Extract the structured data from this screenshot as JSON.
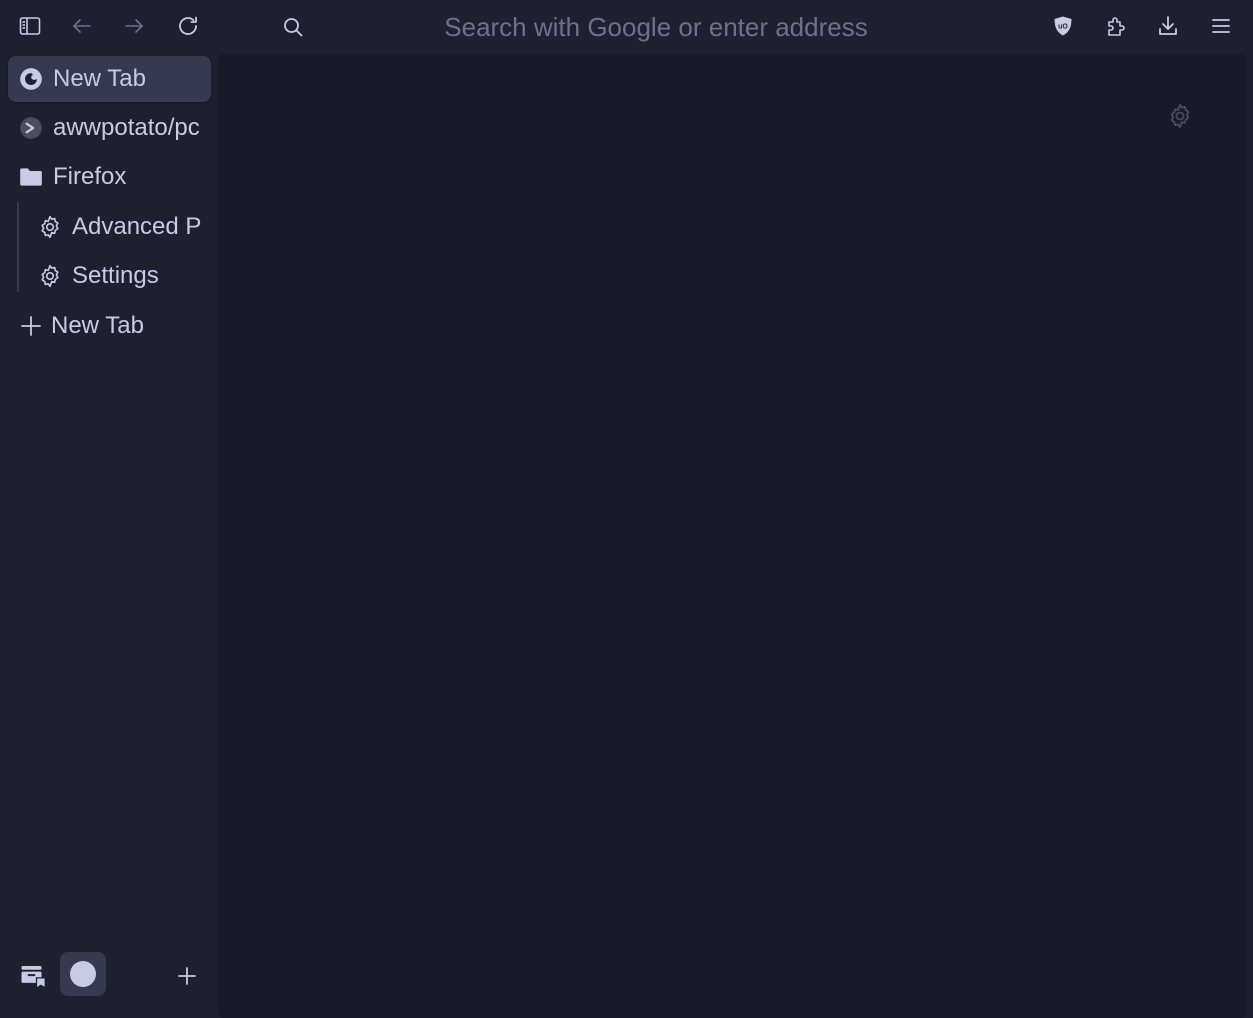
{
  "window": {
    "accent_color": "#c6cbe6",
    "background_color": "#1e2030",
    "content_background_color": "#181a27"
  },
  "toolbar": {
    "sidebar_toggle_icon": "sidebar-icon",
    "back_icon": "arrow-left-icon",
    "forward_icon": "arrow-right-icon",
    "reload_icon": "reload-icon",
    "right_icons": [
      "ublock-shield-icon",
      "extensions-puzzle-icon",
      "download-icon",
      "hamburger-menu-icon"
    ]
  },
  "urlbar": {
    "placeholder": "Search with Google or enter address",
    "value": ""
  },
  "sidebar": {
    "tabs": [
      {
        "label": "New Tab",
        "icon": "firefox-icon",
        "active": true
      },
      {
        "label": "awwpotato/pc",
        "icon": "github-octocat-icon",
        "active": false
      }
    ],
    "folder": {
      "label": "Firefox",
      "icon": "folder-icon",
      "children": [
        {
          "label": "Advanced P",
          "icon": "gear-icon"
        },
        {
          "label": "Settings",
          "icon": "gear-icon"
        }
      ]
    },
    "new_tab_label": "New Tab"
  },
  "sidebar_bottom": {
    "icons": [
      "container-tabs-icon",
      "workspace-icon",
      "plus-icon"
    ]
  },
  "content": {
    "settings_icon": "gear-icon"
  }
}
